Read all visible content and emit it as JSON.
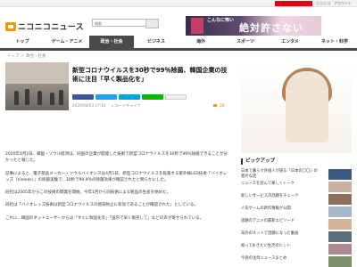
{
  "topbar": {
    "site_label": "ニコニコ動画",
    "items": [
      "ニコニコ",
      "アカウント"
    ]
  },
  "header": {
    "logo_text": "ニコニコニュース",
    "search_placeholder": "検索",
    "ad_small": "こんなに怖い",
    "ad_big": "絶対許さない"
  },
  "nav": {
    "items": [
      "トップ",
      "ゲーム・アニメ",
      "政治・社会",
      "ビジネス",
      "海外",
      "スポーツ",
      "エンタメ",
      "ネット・科学"
    ],
    "active_index": 2
  },
  "breadcrumb": "トップ ＞ 政治・社会",
  "article": {
    "title": "新型コロナウイルスを30秒で99％除菌、韓国企業の技術に注目「早く製品化を」",
    "date": "2020/04/03 17:10",
    "source": "レコードチャイナ",
    "comment_count": "36",
    "paragraphs": [
      "2020年4月2日、韓国・ソウル経済は、同国の企業が開発した技術で新型コロナウイルスを30秒で99％除菌できることが分かったと報じた。",
      "記事によると、電子部品メーカー・ソウルバイオシスは4月1日、新型コロナウイルスを殺菌する紫外線LED技術「バイオレッズ（Violeds）」の除菌実験で、30秒で99.9％の除菌効果が確認されたと明らかにした。",
      "同社は2005年からこの技術の開発を開始。今年1月から同技術による製品の生産を始めた。",
      "同社は「バイオレッズ技術は新型コロナウイルスの感染防止に有効であることが確認された」としている。",
      "これに、韓国のネットユーザーからは「すぐに製品化を」「国内で早く販売して」などの声が寄せられている。"
    ]
  },
  "sidebar": {
    "pickup_title": "ピックアップ",
    "pickup_items": [
      "日本で暮らす外国人が語る「日本の〇〇」の意外な話",
      "ニュースを読んで楽しくトーク",
      "新しいサービスの話題をチェック",
      "人気ゲームの新作情報が公開",
      "話題のアニメの最新エピソード",
      "海外のネットで話題になった動画",
      "知っておきたい生活のヒント",
      "今週の注目ニュースまとめ"
    ]
  }
}
